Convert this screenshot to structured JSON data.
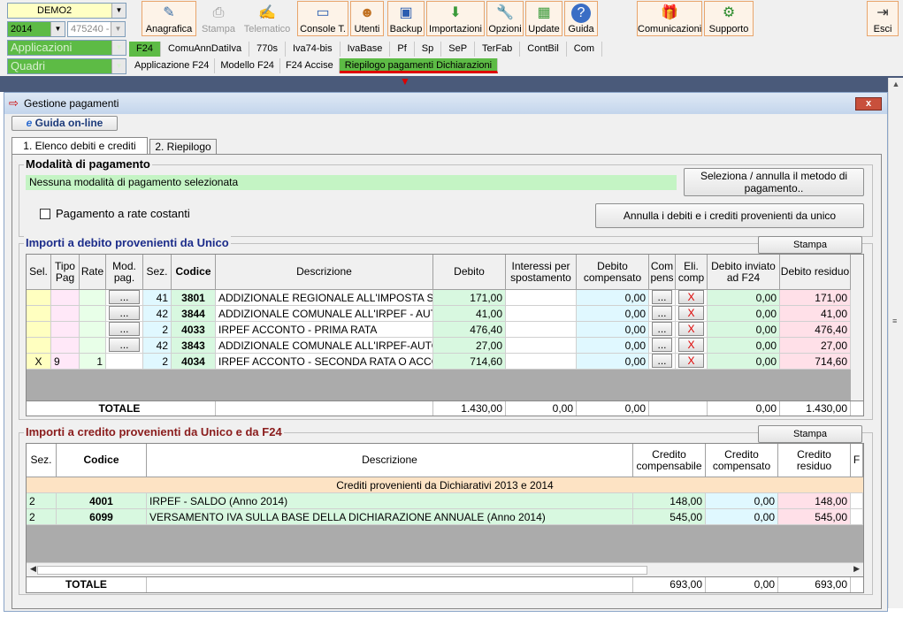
{
  "toolbar": {
    "company": "DEMO2",
    "year": "2014",
    "code": "475240 -",
    "applicazioni": "Applicazioni",
    "quadri": "Quadri",
    "buttons": [
      "Anagrafica",
      "Stampa",
      "Telematico",
      "Console T.",
      "Utenti",
      "Backup",
      "Importazioni",
      "Opzioni",
      "Update",
      "Guida",
      "Comunicazioni",
      "Supporto",
      "Esci"
    ]
  },
  "tabs_row1": [
    "F24",
    "ComuAnnDatiIva",
    "770s",
    "Iva74-bis",
    "IvaBase",
    "Pf",
    "Sp",
    "SeP",
    "TerFab",
    "ContBil",
    "Com"
  ],
  "tabs_row2": [
    "Applicazione F24",
    "Modello F24",
    "F24 Accise",
    "Riepilogo pagamenti Dichiarazioni"
  ],
  "window": {
    "title": "Gestione pagamenti",
    "close": "x",
    "guide_button": "Guida on-line",
    "tabs": [
      "1. Elenco debiti e crediti",
      "2. Riepilogo"
    ]
  },
  "modalita": {
    "title": "Modalità di pagamento",
    "status": "Nessuna modalità di pagamento selezionata",
    "select_button": "Seleziona / annulla il metodo di pagamento..",
    "rate_checkbox": "Pagamento a rate costanti",
    "cancel_button": "Annulla i debiti e i crediti provenienti da unico"
  },
  "debiti": {
    "title": "Importi a debito provenienti da Unico",
    "print": "Stampa",
    "headers": [
      "Sel.",
      "Tipo Pag",
      "Rate",
      "Mod. pag.",
      "Sez.",
      "Codice",
      "Descrizione",
      "Debito",
      "Interessi per spostamento",
      "Debito compensato",
      "Com pens",
      "Eli. comp",
      "Debito inviato ad F24",
      "Debito residuo"
    ],
    "rows": [
      {
        "sel": "",
        "tipo": "",
        "rate": "",
        "mod": "...",
        "sez": "41",
        "codice": "3801",
        "desc": "ADDIZIONALE REGIONALE ALL'IMPOSTA SU",
        "debito": "171,00",
        "interessi": "",
        "compensato": "0,00",
        "compens": "...",
        "eli": "X",
        "inviato": "0,00",
        "residuo": "171,00"
      },
      {
        "sel": "",
        "tipo": "",
        "rate": "",
        "mod": "...",
        "sez": "42",
        "codice": "3844",
        "desc": "ADDIZIONALE COMUNALE ALL'IRPEF - AUTO",
        "debito": "41,00",
        "interessi": "",
        "compensato": "0,00",
        "compens": "...",
        "eli": "X",
        "inviato": "0,00",
        "residuo": "41,00"
      },
      {
        "sel": "",
        "tipo": "",
        "rate": "",
        "mod": "...",
        "sez": "2",
        "codice": "4033",
        "desc": "IRPEF ACCONTO - PRIMA RATA",
        "debito": "476,40",
        "interessi": "",
        "compensato": "0,00",
        "compens": "...",
        "eli": "X",
        "inviato": "0,00",
        "residuo": "476,40"
      },
      {
        "sel": "",
        "tipo": "",
        "rate": "",
        "mod": "...",
        "sez": "42",
        "codice": "3843",
        "desc": "ADDIZIONALE COMUNALE ALL'IRPEF-AUTOT",
        "debito": "27,00",
        "interessi": "",
        "compensato": "0,00",
        "compens": "...",
        "eli": "X",
        "inviato": "0,00",
        "residuo": "27,00"
      },
      {
        "sel": "X",
        "tipo": "9",
        "rate": "1",
        "mod": "",
        "sez": "2",
        "codice": "4034",
        "desc": "IRPEF ACCONTO - SECONDA RATA O ACCON",
        "debito": "714,60",
        "interessi": "",
        "compensato": "0,00",
        "compens": "...",
        "eli": "X",
        "inviato": "0,00",
        "residuo": "714,60"
      }
    ],
    "totale_label": "TOTALE",
    "totale": {
      "debito": "1.430,00",
      "interessi": "0,00",
      "compensato": "0,00",
      "inviato": "0,00",
      "residuo": "1.430,00"
    }
  },
  "crediti": {
    "title": "Importi a credito provenienti da Unico e da F24",
    "print": "Stampa",
    "headers": [
      "Sez.",
      "Codice",
      "Descrizione",
      "Credito compensabile",
      "Credito compensato",
      "Credito residuo",
      "F"
    ],
    "group_label": "Crediti provenienti da Dichiarativi 2013 e 2014",
    "rows": [
      {
        "sez": "2",
        "codice": "4001",
        "desc": "IRPEF - SALDO (Anno 2014)",
        "compensabile": "148,00",
        "compensato": "0,00",
        "residuo": "148,00"
      },
      {
        "sez": "2",
        "codice": "6099",
        "desc": "VERSAMENTO IVA SULLA BASE DELLA DICHIARAZIONE ANNUALE (Anno 2014)",
        "compensabile": "545,00",
        "compensato": "0,00",
        "residuo": "545,00"
      }
    ],
    "totale_label": "TOTALE",
    "totale": {
      "compensabile": "693,00",
      "compensato": "0,00",
      "residuo": "693,00"
    }
  }
}
